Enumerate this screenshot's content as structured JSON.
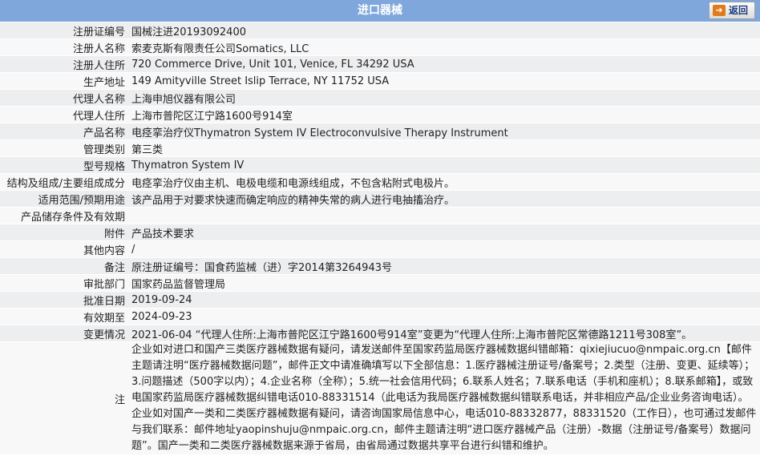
{
  "title": "进口器械",
  "back_label": "返回",
  "rows": [
    {
      "label": "注册证编号",
      "value": "国械注进20193092400"
    },
    {
      "label": "注册人名称",
      "value": "索麦克斯有限责任公司Somatics, LLC"
    },
    {
      "label": "注册人住所",
      "value": "720 Commerce Drive, Unit 101, Venice, FL 34292 USA"
    },
    {
      "label": "生产地址",
      "value": "149 Amityville Street Islip Terrace, NY 11752 USA"
    },
    {
      "label": "代理人名称",
      "value": "上海申旭仪器有限公司"
    },
    {
      "label": "代理人住所",
      "value": "上海市普陀区江宁路1600号914室"
    },
    {
      "label": "产品名称",
      "value": "电痉挛治疗仪Thymatron System IV Electroconvulsive Therapy Instrument"
    },
    {
      "label": "管理类别",
      "value": "第三类"
    },
    {
      "label": "型号规格",
      "value": "Thymatron System IV"
    },
    {
      "label": "结构及组成/主要组成成分",
      "value": "电痉挛治疗仪由主机、电极电缆和电源线组成，不包含粘附式电极片。"
    },
    {
      "label": "适用范围/预期用途",
      "value": "该产品用于对要求快速而确定响应的精神失常的病人进行电抽搐治疗。"
    },
    {
      "label": "产品储存条件及有效期",
      "value": ""
    },
    {
      "label": "附件",
      "value": "产品技术要求"
    },
    {
      "label": "其他内容",
      "value": "/"
    },
    {
      "label": "备注",
      "value": "原注册证编号：国食药监械（进）字2014第3264943号"
    },
    {
      "label": "审批部门",
      "value": "国家药品监督管理局"
    },
    {
      "label": "批准日期",
      "value": "2019-09-24"
    },
    {
      "label": "有效期至",
      "value": "2024-09-23"
    },
    {
      "label": "变更情况",
      "value": "2021-06-04 “代理人住所:上海市普陀区江宁路1600号914室”变更为“代理人住所:上海市普陀区常德路1211号308室”。"
    }
  ],
  "note": {
    "label": "注",
    "text": "企业如对进口和国产三类医疗器械数据有疑问，请发送邮件至国家药监局医疗器械数据纠错邮箱：qixiejiucuo@nmpaic.org.cn【邮件主题请注明“医疗器械数据问题”，邮件正文中请准确填写以下全部信息：1.医疗器械注册证号/备案号；2.类型（注册、变更、延续等）；3.问题描述（500字以内）；4.企业名称（全称）；5.统一社会信用代码；6.联系人姓名；7.联系电话（手机和座机）；8.联系邮箱】，或致电国家药监局医疗器械数据纠错电话010-88331514（此电话为我局医疗器械数据纠错联系电话，并非相应产品/企业业务咨询电话）。企业如对国产一类和二类医疗器械数据有疑问，请咨询国家局信息中心，电话010-88332877，88331520（工作日），也可通过发邮件与我们联系：邮件地址yaopinshuju@nmpaic.org.cn，邮件主题请注明“进口医疗器械产品（注册）-数据（注册证号/备案号）数据问题”。国产一类和二类医疗器械数据来源于省局，由省局通过数据共享平台进行纠错和维护。"
  }
}
